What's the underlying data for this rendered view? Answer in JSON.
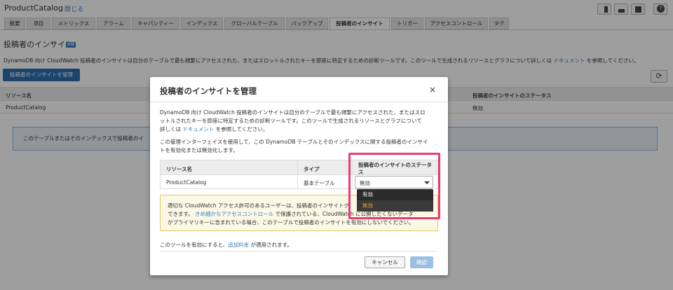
{
  "header": {
    "title": "ProductCatalog",
    "close_label": "閉じる"
  },
  "tabs": [
    "概要",
    "項目",
    "メトリックス",
    "アラーム",
    "キャパシティー",
    "インデックス",
    "グローバルテーブル",
    "バックアップ",
    "投稿者のインサイト",
    "トリガー",
    "アクセスコントロール",
    "タグ"
  ],
  "active_tab": "投稿者のインサイト",
  "page": {
    "section_title": "投稿者のインサイト",
    "badge": "新機",
    "description_prefix": "DynamoDB 向け CloudWatch 投稿者のインサイトは自分のテーブルで最も頻繁にアクセスされた、またはスロットルされたキーを即座に特定するための診断ツールです。このツールで生成されるリソースとグラフについて詳しくは",
    "description_link": "ドキュメント",
    "description_suffix": "を参照してください。",
    "manage_button": "投稿者のインサイトを管理",
    "refresh_icon": "refresh-icon",
    "table": {
      "col_resource": "リソース名",
      "col_status": "投稿者のインサイトのステータス",
      "row": {
        "resource": "ProductCatalog",
        "status": "無効"
      }
    },
    "info_text": "このテーブルまたはそのインデックスで投稿者のイ"
  },
  "modal": {
    "title": "投稿者のインサイトを管理",
    "close_icon": "×",
    "p1_line1": "DynamoDB 向け CloudWatch 投稿者のインサイトは自分のテーブルで最も頻繁にアクセスされた、またはスロ",
    "p1_line2": "ットルされたキーを即座に特定するための診断ツールです。このツールで生成されるリソースとグラフについて",
    "p1_line3_prefix": "詳しくは",
    "p1_link": "ドキュメント",
    "p1_line3_suffix": "を参照してください。",
    "p2_line1": "この管理インターフェイスを使用して、この DynamoDB テーブルとそのインデックスに関する投稿者のインサイ",
    "p2_line2": "トを有効化または無効化します。",
    "table": {
      "col_resource": "リソース名",
      "col_type": "タイプ",
      "col_status_l1": "投稿者のインサイトのステータ",
      "col_status_l2": "ス",
      "row": {
        "resource": "ProductCatalog",
        "type": "基本テーブル"
      }
    },
    "select": {
      "value": "無効",
      "options": [
        "有効",
        "無効"
      ]
    },
    "warning": {
      "line1": "適切な CloudWatch アクセス許可のあるユーザーは、投稿者のインサイトグ",
      "line2_prefix": "できます。",
      "line2_link": "きめ細かなアクセスコントロール",
      "line2_suffix": "で保護されている、CloudWatch に公開したくないデータ",
      "line3": "がプライマリキーに含まれている場合、このテーブルで投稿者のインサイトを有効にしないでください。"
    },
    "cost_prefix": "このツールを有効にすると、",
    "cost_link": "追加料金",
    "cost_suffix": "が適用されます。",
    "cancel_button": "キャンセル",
    "confirm_button": "確認"
  },
  "colors": {
    "primary": "#2c6fb0",
    "link": "#3b7cc1",
    "highlight": "#ec3a78",
    "warning_bg": "#fcf8e6",
    "info_bg": "#eaf2fb"
  }
}
